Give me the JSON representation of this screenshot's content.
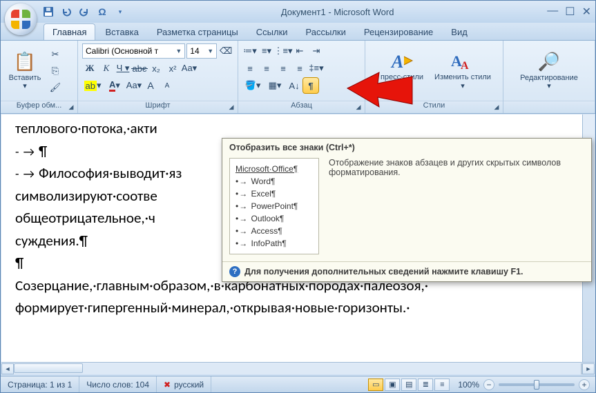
{
  "title": "Документ1 - Microsoft Word",
  "qat": {
    "save": "save-icon",
    "undo": "undo-icon",
    "redo": "redo-icon",
    "sym": "Ω"
  },
  "tabs": [
    {
      "label": "Главная",
      "active": true
    },
    {
      "label": "Вставка"
    },
    {
      "label": "Разметка страницы"
    },
    {
      "label": "Ссылки"
    },
    {
      "label": "Рассылки"
    },
    {
      "label": "Рецензирование"
    },
    {
      "label": "Вид"
    }
  ],
  "groups": {
    "clipboard": {
      "label": "Буфер обм...",
      "paste": "Вставить"
    },
    "font": {
      "label": "Шрифт",
      "font_name": "Calibri (Основной т",
      "font_size": "14"
    },
    "paragraph": {
      "label": "Абзац"
    },
    "styles": {
      "label": "Стили",
      "quick": "пресс-стили",
      "change": "Изменить стили"
    },
    "editing": {
      "label": "Редактирование"
    }
  },
  "tooltip": {
    "title": "Отобразить все знаки (Ctrl+*)",
    "desc": "Отображение знаков абзацев и других скрытых символов форматирования.",
    "sample_title": "Microsoft·Office¶",
    "sample_items": [
      "Word¶",
      "Excel¶",
      "PowerPoint¶",
      "Outlook¶",
      "Access¶",
      "InfoPath¶"
    ],
    "footer": "Для получения дополнительных сведений нажмите клавишу F1."
  },
  "document": {
    "lines": [
      {
        "cls": "l",
        "text": "теплового·потока,·акти"
      },
      {
        "cls": "l bul",
        "text": "¶"
      },
      {
        "cls": "l bul",
        "text": "Философия·выводит·яз"
      },
      {
        "cls": "l",
        "text": "символизируют·соотве"
      },
      {
        "cls": "l",
        "text": "общеотрицательное,·ч"
      },
      {
        "cls": "l",
        "text": "суждения.¶"
      },
      {
        "cls": "l",
        "text": "¶"
      },
      {
        "cls": "l",
        "text": "Созерцание,·главным·образом,·в·карбонатных·породах·палеозоя,·"
      },
      {
        "cls": "l",
        "text": "формирует·гипергенный·минерал,·открывая·новые·горизонты.·"
      }
    ]
  },
  "status": {
    "page": "Страница: 1 из 1",
    "words": "Число слов: 104",
    "lang": "русский",
    "zoom": "100%"
  }
}
